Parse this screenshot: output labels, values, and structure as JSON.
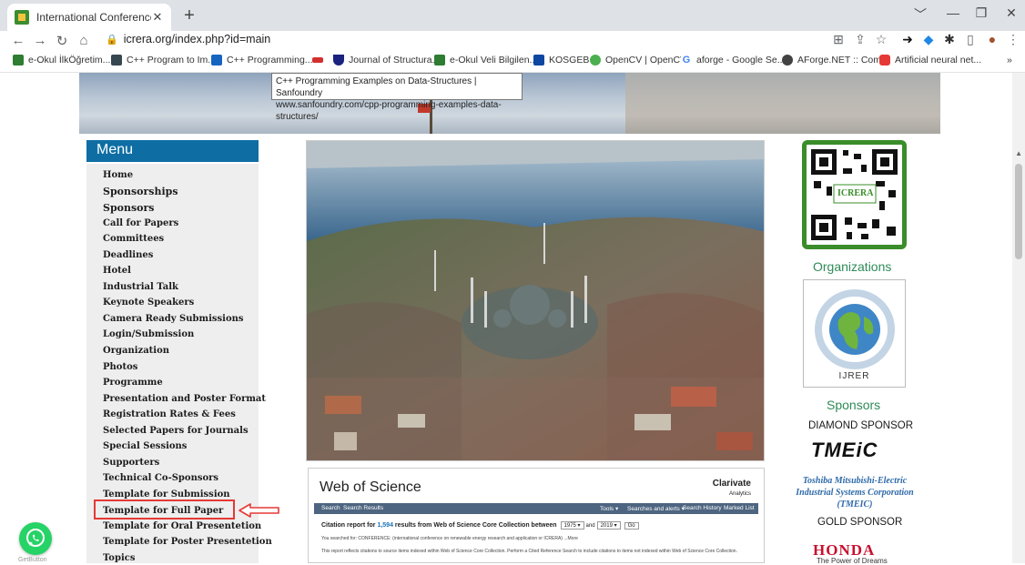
{
  "browser": {
    "tab_title": "International Conference on Rene",
    "tab_close": "✕",
    "new_tab": "+",
    "url": "icrera.org/index.php?id=main",
    "window_controls": [
      "﹀",
      "—",
      "❐",
      "✕"
    ]
  },
  "bookmarks": [
    {
      "label": "e-Okul İlkÖğretim...",
      "color": "#2e7d32"
    },
    {
      "label": "C++ Program to Im...",
      "color": "#37474f"
    },
    {
      "label": "C++ Programming...",
      "color": "#1565c0"
    },
    {
      "label": "",
      "color": "#d32f2f"
    },
    {
      "label": "Journal of Structura...",
      "color": "#1a237e"
    },
    {
      "label": "e-Okul Veli Bilgilen...",
      "color": "#2e7d32"
    },
    {
      "label": "KOSGEB",
      "color": "#0d47a1"
    },
    {
      "label": "OpenCV | OpenCV",
      "color": "#4caf50"
    },
    {
      "label": "aforge - Google Se...",
      "color": "#4285f4"
    },
    {
      "label": "AForge.NET :: Com...",
      "color": "#424242"
    },
    {
      "label": "Artificial neural net...",
      "color": "#e53935"
    }
  ],
  "bookmarks_more": "»",
  "tooltip": {
    "line1": "C++ Programming Examples on Data-Structures | Sanfoundry",
    "line2": "www.sanfoundry.com/cpp-programming-examples-data-structures/"
  },
  "menu": {
    "heading": "Menu",
    "items": [
      "Home",
      "Sponsorships",
      "Sponsors",
      "Call for Papers",
      "Committees",
      "Deadlines",
      "Hotel",
      "Industrial Talk",
      "Keynote Speakers",
      "Camera Ready Submissions",
      "Login/Submission",
      "Organization",
      "Photos",
      "Programme",
      "Presentation and Poster Format",
      "Registration Rates & Fees",
      "Selected Papers for Journals",
      "Special Sessions",
      "Supporters",
      "Technical Co-Sponsors",
      "Template for Submission",
      "Template for Full Paper",
      "Template for Oral Presentetion",
      "Template for Poster Presentetion",
      "Topics"
    ]
  },
  "wos": {
    "title": "Web of Science",
    "logo": "Clarivate",
    "logo_sub": "Analytics",
    "bar_left": [
      "Search",
      "Search Results"
    ],
    "bar_right": [
      "Tools ▾",
      "Searches and alerts ▾",
      "Search History",
      "Marked List"
    ],
    "report_prefix": "Citation report for ",
    "report_count": "1,594",
    "report_suffix": " results from Web of Science Core Collection   between",
    "year_from": "1975 ▾",
    "and": "and",
    "year_to": "2019 ▾",
    "go": "Go",
    "searched_for": "You searched for: CONFERENCE: (international conference on renewable energy research and application or ICRERA) ...More",
    "note": "This report reflects citations to source items indexed within Web of Science Core Collection. Perform a Cited Reference Search to include citations to items not indexed within Web of Science Core Collection."
  },
  "right": {
    "qr_text": "ICRERA",
    "organizations": "Organizations",
    "ijrer": "IJRER",
    "sponsors": "Sponsors",
    "diamond": "DIAMOND SPONSOR",
    "tmeic": "TMEiC",
    "toshiba": "Toshiba Mitsubishi-Electric Industrial Systems Corporation (TMEIC)",
    "gold": "GOLD SPONSOR",
    "honda": "HONDA",
    "honda_sub": "The Power of Dreams"
  },
  "widget": {
    "getbutton": "GetButton"
  }
}
